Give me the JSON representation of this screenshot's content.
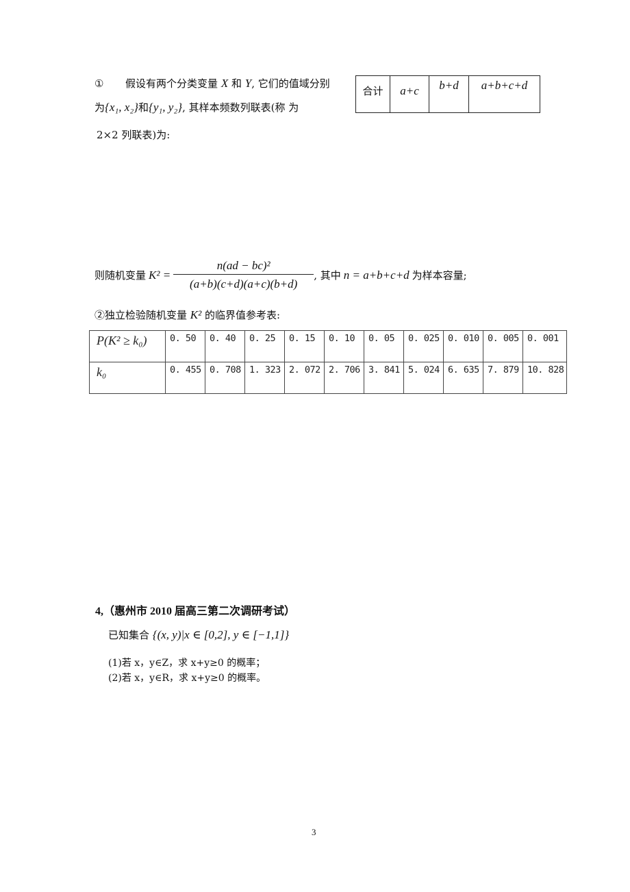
{
  "section1": {
    "marker": "①",
    "line1_pre": "假设有两个分类变量",
    "var_x": "X",
    "and": "和",
    "var_y": "Y",
    "line1_post": ", 它们的值域分别",
    "line2_pre": "为",
    "set_x": "{x₁,  x₂}",
    "set_y": "{y₁,  y₂}",
    "line2_post": ", 其样本频数列联表(称  为",
    "line3": "2×2 列联表)为:"
  },
  "summary_table": {
    "cells": [
      "合计",
      "a+c",
      "b+d",
      "a+b+c+d"
    ]
  },
  "formula": {
    "prefix": "则随机变量",
    "lhs": "K² =",
    "numerator": "n(ad − bc)²",
    "denominator": "(a+b)(c+d)(a+c)(b+d)",
    "mid": ", 其中",
    "n_def": "n = a+b+c+d",
    "suffix": "为样本容量;"
  },
  "section2": {
    "title_pre": "②独立检验随机变量",
    "title_var": "K²",
    "title_post": "的临界值参考表:"
  },
  "critical_table": {
    "row1_header": "P(K² ≥ k₀)",
    "row2_header": "k₀",
    "p_values": [
      "0. 50",
      "0. 40",
      "0. 25",
      "0. 15",
      "0. 10",
      "0. 05",
      "0. 025",
      "0. 010",
      "0. 005",
      "0. 001"
    ],
    "k_values": [
      "0. 455",
      "0. 708",
      "1. 323",
      "2. 072",
      "2. 706",
      "3. 841",
      "5. 024",
      "6. 635",
      "7. 879",
      "10. 828"
    ]
  },
  "problem4": {
    "heading": "4,（惠州市 2010 届高三第二次调研考试）",
    "given_pre": "已知集合",
    "set_expr": "{(x, y)|x ∈ [0,2], y ∈ [−1,1]}",
    "q1": "(1)若 x，y∈Z，求 x+y≥0 的概率；",
    "q2": "(2)若 x，y∈R，求 x+y≥0 的概率。"
  },
  "page_number": "3"
}
